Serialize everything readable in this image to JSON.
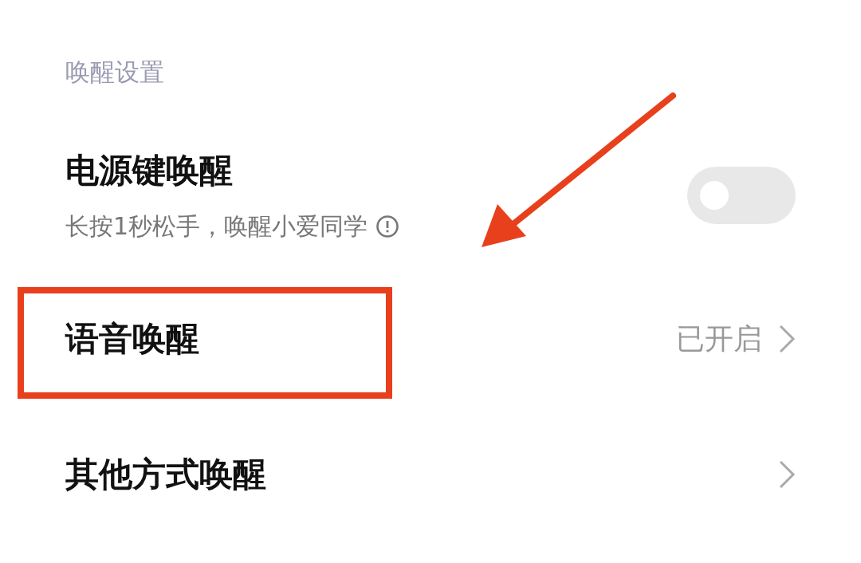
{
  "section_title": "唤醒设置",
  "items": [
    {
      "kind": "toggle",
      "title": "电源键唤醒",
      "subtitle": "长按1秒松手，唤醒小爱同学",
      "info": true,
      "on": false
    },
    {
      "kind": "link",
      "title": "语音唤醒",
      "value": "已开启",
      "highlighted": true
    },
    {
      "kind": "link",
      "title": "其他方式唤醒",
      "highlighted": false
    }
  ],
  "annotation_arrow": true
}
